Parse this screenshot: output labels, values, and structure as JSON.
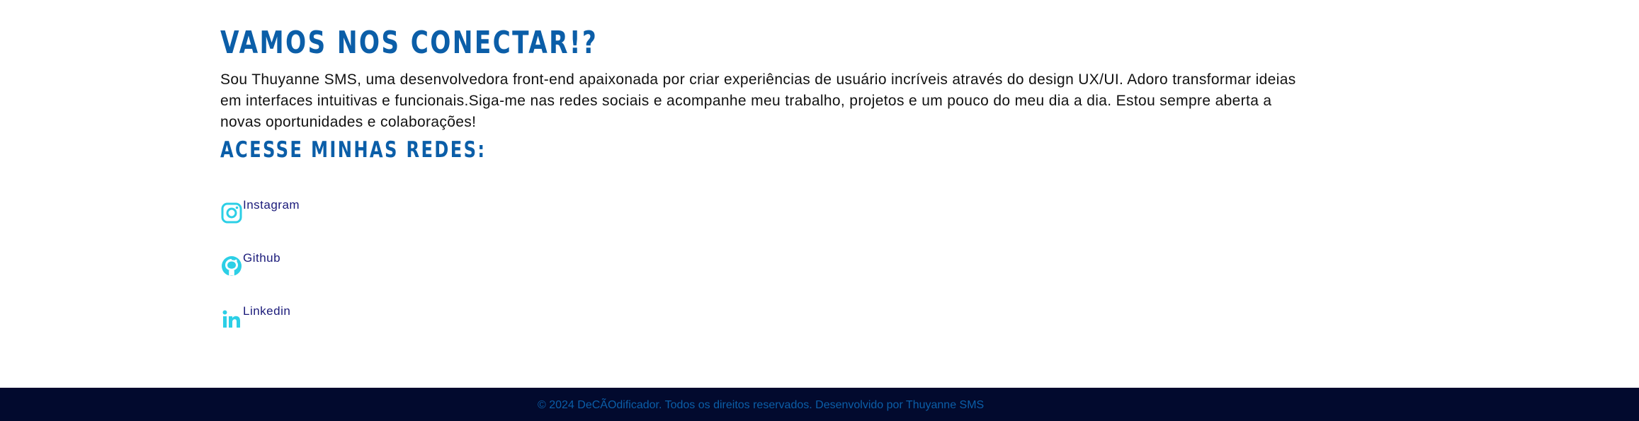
{
  "heading": {
    "title": "VAMOS NOS CONECTAR!?",
    "intro": "Sou Thuyanne SMS, uma desenvolvedora front-end apaixonada por criar experiências de usuário incríveis através do design UX/UI. Adoro transformar ideias em interfaces intuitivas e funcionais.Siga-me nas redes sociais e acompanhe meu trabalho, projetos e um pouco do meu dia a dia. Estou sempre aberta a novas oportunidades e colaborações!",
    "subtitle": "ACESSE MINHAS REDES:"
  },
  "social": {
    "items": [
      {
        "label": "Instagram",
        "icon": "instagram-icon"
      },
      {
        "label": "Github",
        "icon": "github-icon"
      },
      {
        "label": "Linkedin",
        "icon": "linkedin-icon"
      }
    ]
  },
  "footer": {
    "text": "© 2024 DeCÃOdificador. Todos os direitos reservados. Desenvolvido por Thuyanne SMS"
  },
  "colors": {
    "accent": "#0b5ea8",
    "icon": "#2ccfe6",
    "link": "#1a1a7a",
    "footer_bg": "#020a2e"
  }
}
